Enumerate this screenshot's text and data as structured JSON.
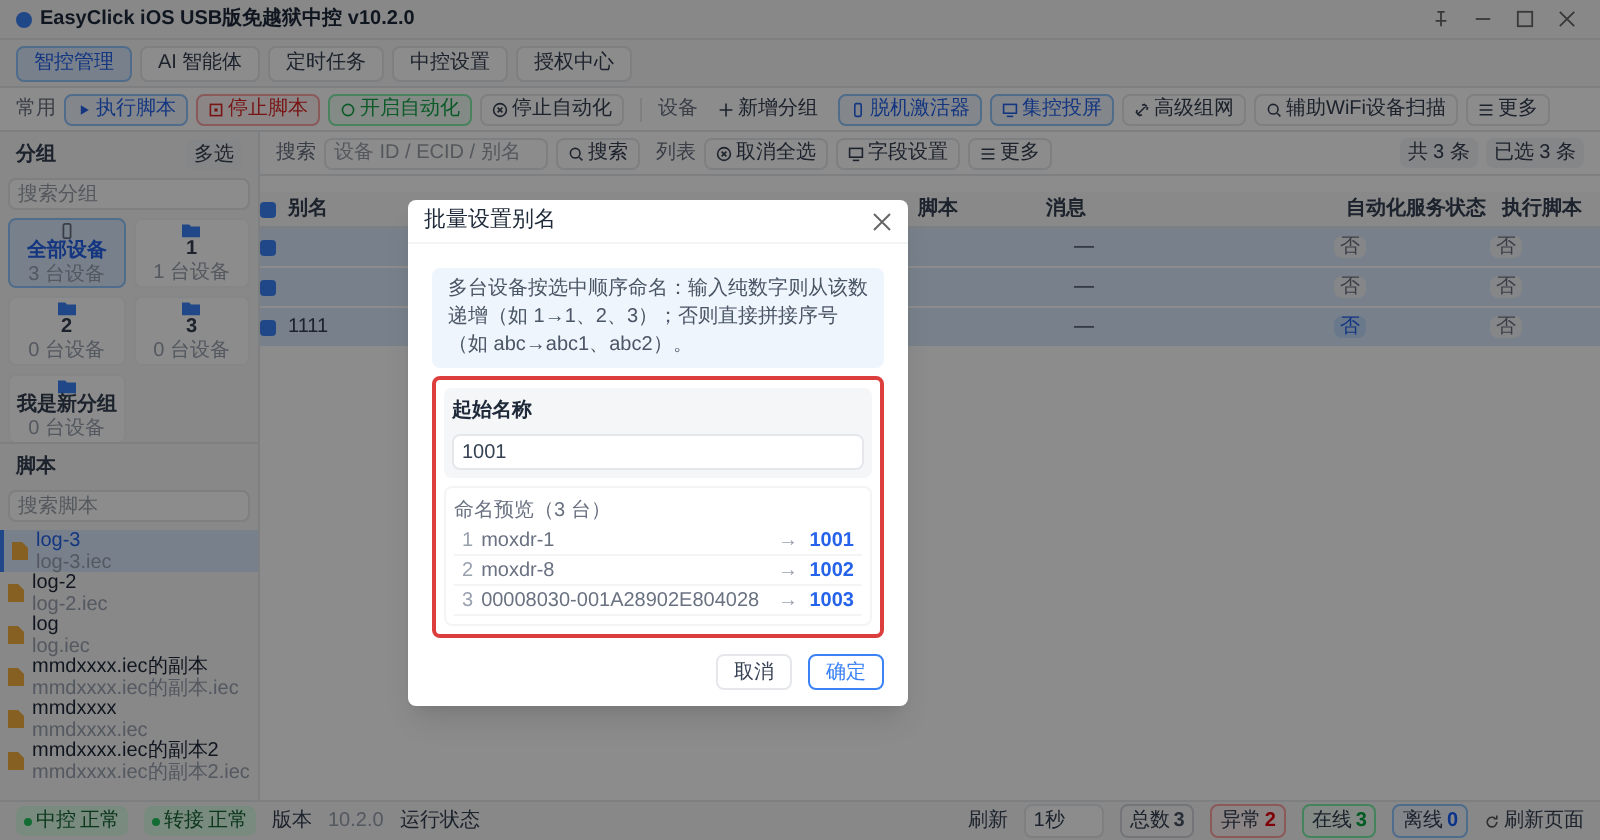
{
  "window": {
    "title": "EasyClick iOS USB版免越狱中控 v10.2.0"
  },
  "nav_tabs": [
    {
      "label": "智控管理",
      "selected": true
    },
    {
      "label": "AI 智能体",
      "selected": false
    },
    {
      "label": "定时任务",
      "selected": false
    },
    {
      "label": "中控设置",
      "selected": false
    },
    {
      "label": "授权中心",
      "selected": false
    }
  ],
  "toolbar": [
    {
      "label": "常用",
      "buttons": [
        {
          "label": "执行脚本",
          "kind": "primary"
        },
        {
          "label": "停止脚本",
          "kind": "danger"
        },
        {
          "label": "开启自动化",
          "kind": "success"
        },
        {
          "label": "停止自动化",
          "kind": "default"
        }
      ]
    },
    {
      "label": "设备",
      "buttons": [
        {
          "label": "新增分组",
          "kind": "plain"
        },
        {
          "label": "脱机激活器",
          "kind": "primary"
        },
        {
          "label": "集控投屏",
          "kind": "primary"
        },
        {
          "label": "高级组网",
          "kind": "default"
        },
        {
          "label": "辅助WiFi设备扫描",
          "kind": "default"
        },
        {
          "label": "更多",
          "kind": "default"
        }
      ]
    }
  ],
  "groups": {
    "title": "分组",
    "multi_select": "多选",
    "search_placeholder": "搜索分组",
    "items": [
      {
        "name": "全部设备",
        "count": "3 台设备",
        "selected": true,
        "kind": "all"
      },
      {
        "name": "1",
        "count": "1 台设备",
        "selected": false,
        "kind": "folder"
      },
      {
        "name": "2",
        "count": "0 台设备",
        "selected": false,
        "kind": "folder"
      },
      {
        "name": "3",
        "count": "0 台设备",
        "selected": false,
        "kind": "folder"
      },
      {
        "name": "我是新分组",
        "count": "0 台设备",
        "selected": false,
        "kind": "folder"
      }
    ]
  },
  "scripts": {
    "title": "脚本",
    "search_placeholder": "搜索脚本",
    "items": [
      {
        "name": "log-3",
        "file": "log-3.iec",
        "selected": true
      },
      {
        "name": "log-2",
        "file": "log-2.iec",
        "selected": false
      },
      {
        "name": "log",
        "file": "log.iec",
        "selected": false
      },
      {
        "name": "mmdxxxx.iec的副本",
        "file": "mmdxxxx.iec的副本.iec",
        "selected": false
      },
      {
        "name": "mmdxxxx",
        "file": "mmdxxxx.iec",
        "selected": false
      },
      {
        "name": "mmdxxxx.iec的副本2",
        "file": "mmdxxxx.iec的副本2.iec",
        "selected": false
      }
    ]
  },
  "search_bar": {
    "label": "搜索",
    "placeholder": "设备 ID / ECID / 别名",
    "search_button": "搜索",
    "list_label": "列表",
    "buttons": [
      "取消全选",
      "字段设置",
      "更多"
    ],
    "total": "共 3 条",
    "selected_count": "已选 3 条"
  },
  "table": {
    "all_checked": true,
    "columns": [
      "别名",
      "脚本",
      "消息",
      "自动化服务状态",
      "执行脚本"
    ],
    "rows": [
      {
        "checked": true,
        "alias": "",
        "message": "—",
        "auto_status": "否",
        "auto_on": false,
        "exec_script": "否"
      },
      {
        "checked": true,
        "alias": "",
        "message": "—",
        "auto_status": "否",
        "auto_on": false,
        "exec_script": "否"
      },
      {
        "checked": true,
        "alias": "1111",
        "message": "—",
        "auto_status": "否",
        "auto_on": true,
        "exec_script": "否"
      }
    ]
  },
  "dialog": {
    "title": "批量设置别名",
    "info": "多台设备按选中顺序命名：输入纯数字则从该数递增（如 1→1、2、3）；否则直接拼接序号（如 abc→abc1、abc2）。",
    "start_label": "起始名称",
    "start_value": "1001",
    "preview_title": "命名预览（3 台）",
    "preview": [
      {
        "index": "1",
        "old": "moxdr-1",
        "arrow": "→",
        "new": "1001"
      },
      {
        "index": "2",
        "old": "moxdr-8",
        "arrow": "→",
        "new": "1002"
      },
      {
        "index": "3",
        "old": "00008030-001A28902E804028",
        "arrow": "→",
        "new": "1003"
      }
    ],
    "cancel": "取消",
    "confirm": "确定"
  },
  "status_bar": {
    "left": [
      {
        "label": "中控",
        "value": "正常"
      },
      {
        "label": "转接",
        "value": "正常"
      }
    ],
    "version_label": "版本",
    "version": "10.2.0",
    "run_state": "运行状态",
    "refresh_label": "刷新",
    "refresh_value": "1秒",
    "counters": [
      {
        "label": "总数",
        "value": "3",
        "kind": "total"
      },
      {
        "label": "异常",
        "value": "2",
        "kind": "error"
      },
      {
        "label": "在线",
        "value": "3",
        "kind": "online"
      },
      {
        "label": "离线",
        "value": "0",
        "kind": "offline"
      }
    ],
    "refresh_page": "刷新页面"
  }
}
